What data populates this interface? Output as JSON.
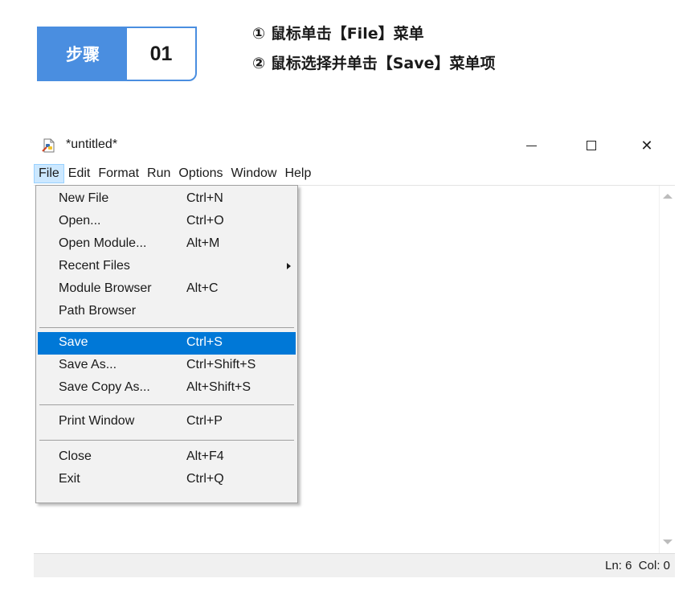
{
  "step": {
    "label": "步骤",
    "number": "01"
  },
  "instructions": [
    "① 鼠标单击【File】菜单",
    "② 鼠标选择并单击【Save】菜单项"
  ],
  "window": {
    "title": "*untitled*",
    "controls": {
      "minimize": "minimize",
      "maximize": "maximize",
      "close": "✕"
    }
  },
  "menu_bar": [
    "File",
    "Edit",
    "Format",
    "Run",
    "Options",
    "Window",
    "Help"
  ],
  "file_menu": {
    "items": [
      {
        "label": "New File",
        "shortcut": "Ctrl+N"
      },
      {
        "label": "Open...",
        "shortcut": "Ctrl+O"
      },
      {
        "label": "Open Module...",
        "shortcut": "Alt+M"
      },
      {
        "label": "Recent Files",
        "shortcut": ""
      },
      {
        "label": "Module Browser",
        "shortcut": "Alt+C"
      },
      {
        "label": "Path Browser",
        "shortcut": ""
      },
      {
        "label": "Save",
        "shortcut": "Ctrl+S"
      },
      {
        "label": "Save As...",
        "shortcut": "Ctrl+Shift+S"
      },
      {
        "label": "Save Copy As...",
        "shortcut": "Alt+Shift+S"
      },
      {
        "label": "Print Window",
        "shortcut": "Ctrl+P"
      },
      {
        "label": "Close",
        "shortcut": "Alt+F4"
      },
      {
        "label": "Exit",
        "shortcut": "Ctrl+Q"
      }
    ],
    "highlighted": "Save"
  },
  "status_bar": {
    "text": "Ln: 6  Col: 0"
  },
  "colors": {
    "accent": "#4a8ee0",
    "highlight": "#0078d7",
    "menu_bg": "#f2f2f2"
  },
  "icons": {
    "app": "python-file-icon",
    "submenu": "chevron-right-icon"
  }
}
